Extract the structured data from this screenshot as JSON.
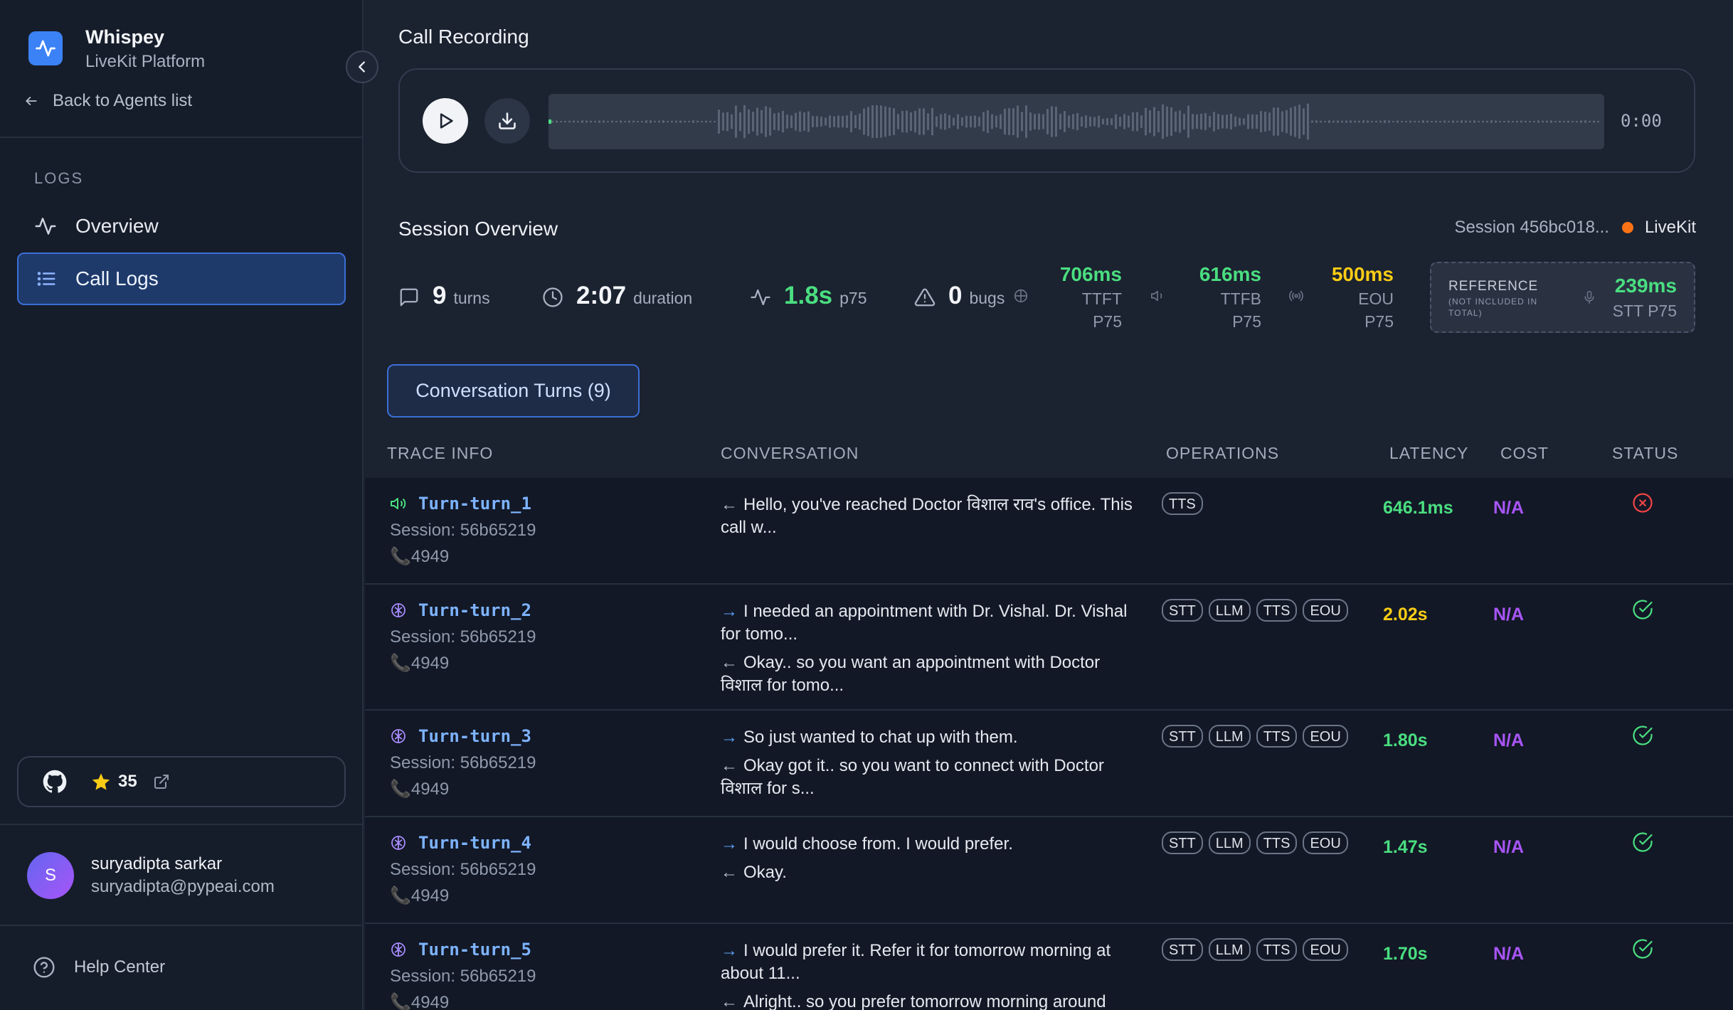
{
  "brand": {
    "name": "Whispey",
    "subtitle": "LiveKit Platform"
  },
  "sidebar": {
    "back_label": "Back to Agents list",
    "section_label": "LOGS",
    "items": [
      {
        "label": "Overview",
        "icon": "activity-icon",
        "active": false
      },
      {
        "label": "Call Logs",
        "icon": "list-icon",
        "active": true
      }
    ],
    "github_stars": "35",
    "user": {
      "initial": "S",
      "name": "suryadipta sarkar",
      "email": "suryadipta@pypeai.com"
    },
    "help_label": "Help Center"
  },
  "recording": {
    "title": "Call Recording",
    "time": "0:00"
  },
  "overview": {
    "title": "Session Overview",
    "session_label": "Session 456bc018...",
    "provider": "LiveKit",
    "turns": {
      "value": "9",
      "unit": "turns"
    },
    "duration": {
      "value": "2:07",
      "unit": "duration"
    },
    "p75": {
      "value": "1.8s",
      "unit": "p75"
    },
    "bugs": {
      "value": "0",
      "unit": "bugs"
    },
    "latencies": [
      {
        "value": "706ms",
        "label1": "TTFT",
        "label2": "P75",
        "color": "#4ade80"
      },
      {
        "value": "616ms",
        "label1": "TTFB",
        "label2": "P75",
        "color": "#4ade80"
      },
      {
        "value": "500ms",
        "label1": "EOU",
        "label2": "P75",
        "color": "#facc15"
      }
    ],
    "reference": {
      "title": "REFERENCE",
      "subtitle": "(NOT INCLUDED IN TOTAL)",
      "value": "239ms",
      "label": "STT P75"
    }
  },
  "tab_label": "Conversation Turns (9)",
  "table": {
    "headers": {
      "trace": "TRACE INFO",
      "conversation": "CONVERSATION",
      "operations": "OPERATIONS",
      "latency": "LATENCY",
      "cost": "COST",
      "status": "STATUS"
    },
    "rows": [
      {
        "name": "Turn-turn_1",
        "session": "Session: 56b65219",
        "phone": "4949",
        "user": "",
        "agent": "Hello, you've reached Doctor विशाल राव's office. This call w...",
        "ops": [
          "TTS"
        ],
        "latency": "646.1ms",
        "latency_color": "#4ade80",
        "cost": "N/A",
        "status": "error"
      },
      {
        "name": "Turn-turn_2",
        "session": "Session: 56b65219",
        "phone": "4949",
        "user": "I needed an appointment with Dr. Vishal. Dr. Vishal for tomo...",
        "agent": "Okay.. so you want an appointment with Doctor विशाल for tomo...",
        "ops": [
          "STT",
          "LLM",
          "TTS",
          "EOU"
        ],
        "latency": "2.02s",
        "latency_color": "#facc15",
        "cost": "N/A",
        "status": "ok"
      },
      {
        "name": "Turn-turn_3",
        "session": "Session: 56b65219",
        "phone": "4949",
        "user": "So just wanted to chat up with them.",
        "agent": "Okay got it.. so you want to connect with Doctor विशाल for s...",
        "ops": [
          "STT",
          "LLM",
          "TTS",
          "EOU"
        ],
        "latency": "1.80s",
        "latency_color": "#4ade80",
        "cost": "N/A",
        "status": "ok"
      },
      {
        "name": "Turn-turn_4",
        "session": "Session: 56b65219",
        "phone": "4949",
        "user": "I would choose from. I would prefer.",
        "agent": "Okay.",
        "ops": [
          "STT",
          "LLM",
          "TTS",
          "EOU"
        ],
        "latency": "1.47s",
        "latency_color": "#4ade80",
        "cost": "N/A",
        "status": "ok"
      },
      {
        "name": "Turn-turn_5",
        "session": "Session: 56b65219",
        "phone": "4949",
        "user": "I would prefer it. Refer it for tomorrow morning at about 11...",
        "agent": "Alright.. so you prefer tomorrow morning around",
        "ops": [
          "STT",
          "LLM",
          "TTS",
          "EOU"
        ],
        "latency": "1.70s",
        "latency_color": "#4ade80",
        "cost": "N/A",
        "status": "ok"
      }
    ]
  }
}
